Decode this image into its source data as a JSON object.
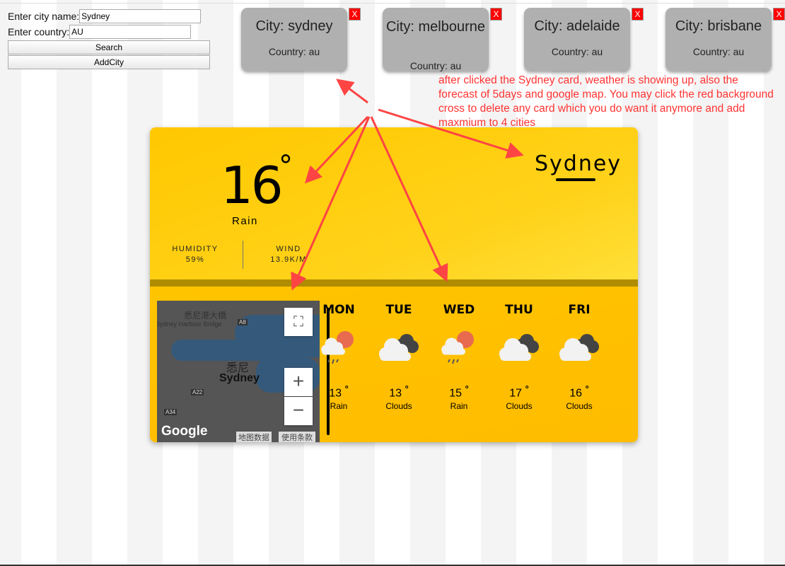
{
  "form": {
    "city_label": "Enter city name:",
    "city_value": "Sydney",
    "country_label": "Enter country:",
    "country_value": "AU",
    "search_label": "Search",
    "add_label": "AddCity"
  },
  "cards": [
    {
      "city": "City: sydney",
      "country": "Country: au"
    },
    {
      "city": "City: melbourne",
      "country": "Country: au"
    },
    {
      "city": "City: adelaide",
      "country": "Country: au"
    },
    {
      "city": "City: brisbane",
      "country": "Country: au"
    }
  ],
  "delete_label": "X",
  "note": "after clicked the Sydney card, weather is showing up, also the forecast of 5days and google map. You may click the red background cross to delete any card which you do want it anymore and add maxmium to 4 cities",
  "current": {
    "temp": "16",
    "deg": "°",
    "desc": "Rain",
    "city": "Sydney",
    "humidity_label": "HUMIDITY",
    "humidity": "59%",
    "wind_label": "WIND",
    "wind": "13.9K/M"
  },
  "map": {
    "label_cn": "悉尼",
    "label": "Sydney",
    "bridge_cn": "悉尼港大橋",
    "bridge": "Sydney Harbour Bridge",
    "logo": "Google",
    "data": "地图数据",
    "terms": "使用条款",
    "roads": [
      "A8",
      "A22",
      "A34"
    ]
  },
  "forecast": [
    {
      "day": "MON",
      "temp": "13",
      "deg": "°",
      "desc": "Rain",
      "icon": "rain-sun"
    },
    {
      "day": "TUE",
      "temp": "13",
      "deg": "°",
      "desc": "Clouds",
      "icon": "clouds"
    },
    {
      "day": "WED",
      "temp": "15",
      "deg": "°",
      "desc": "Rain",
      "icon": "rain-sun"
    },
    {
      "day": "THU",
      "temp": "17",
      "deg": "°",
      "desc": "Clouds",
      "icon": "clouds"
    },
    {
      "day": "FRI",
      "temp": "16",
      "deg": "°",
      "desc": "Clouds",
      "icon": "clouds"
    }
  ],
  "colors": {
    "annotation": "#ff3333",
    "card_bg": "#ffc800",
    "delete": "#ff0000"
  }
}
